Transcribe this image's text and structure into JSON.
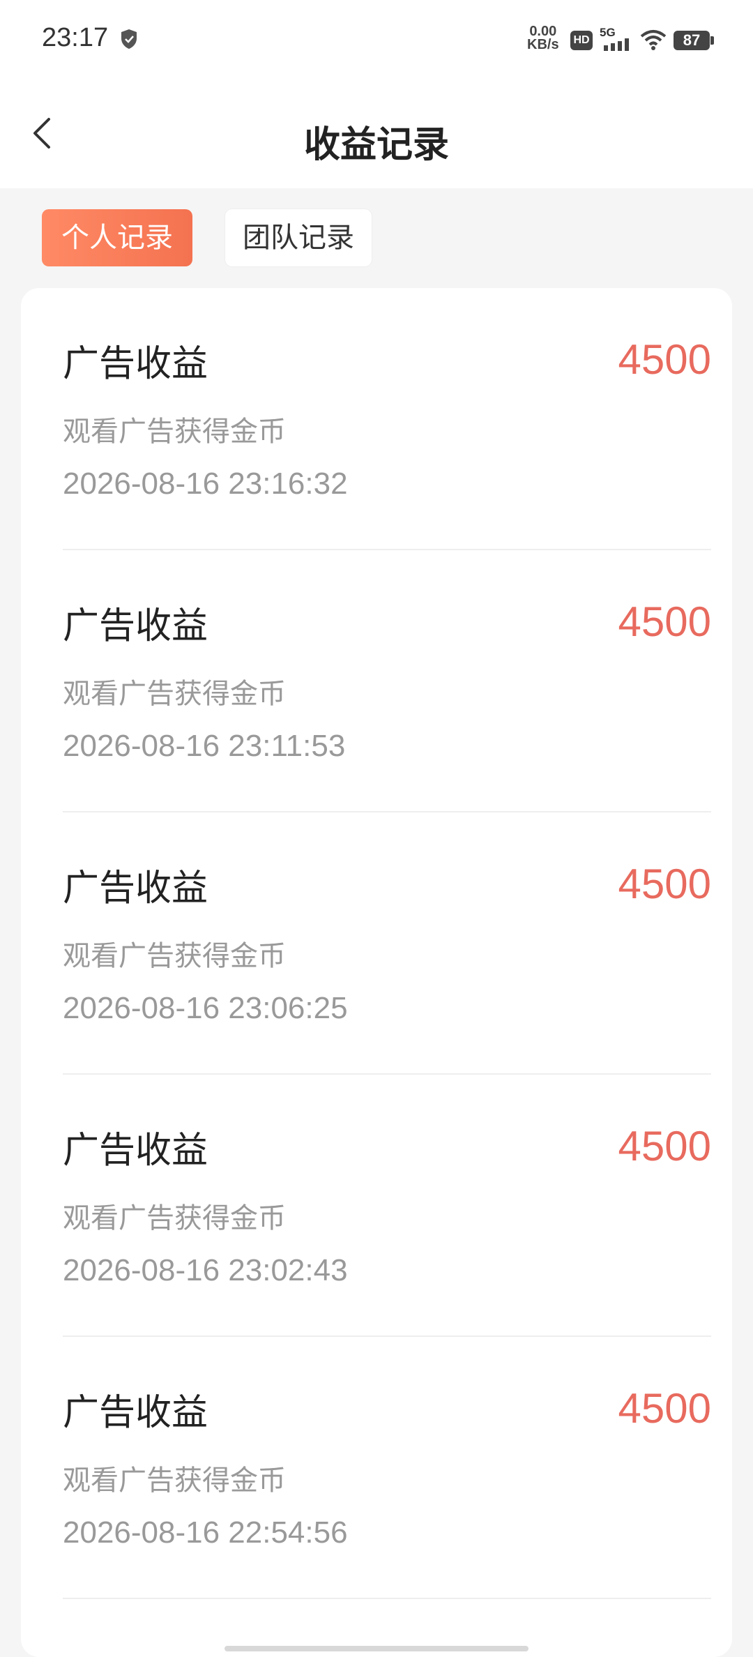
{
  "status_bar": {
    "time": "23:17",
    "net_speed_value": "0.00",
    "net_speed_unit": "KB/s",
    "hd_label": "HD",
    "network_label": "5G",
    "battery": "87"
  },
  "header": {
    "title": "收益记录"
  },
  "tabs": [
    {
      "label": "个人记录",
      "active": true
    },
    {
      "label": "团队记录",
      "active": false
    }
  ],
  "records": [
    {
      "title": "广告收益",
      "amount": "4500",
      "desc": "观看广告获得金币",
      "time": "2026-08-16 23:16:32"
    },
    {
      "title": "广告收益",
      "amount": "4500",
      "desc": "观看广告获得金币",
      "time": "2026-08-16 23:11:53"
    },
    {
      "title": "广告收益",
      "amount": "4500",
      "desc": "观看广告获得金币",
      "time": "2026-08-16 23:06:25"
    },
    {
      "title": "广告收益",
      "amount": "4500",
      "desc": "观看广告获得金币",
      "time": "2026-08-16 23:02:43"
    },
    {
      "title": "广告收益",
      "amount": "4500",
      "desc": "观看广告获得金币",
      "time": "2026-08-16 22:54:56"
    }
  ],
  "colors": {
    "accent": "#f47250",
    "amount": "#e86a5e"
  }
}
